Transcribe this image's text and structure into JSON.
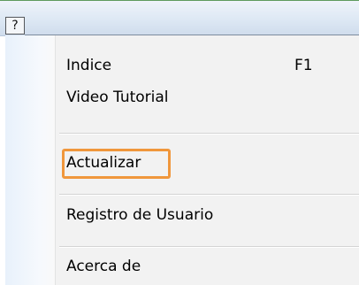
{
  "menubar": {
    "help_label": "?"
  },
  "menu": {
    "items": [
      {
        "label": "Indice",
        "shortcut": "F1"
      },
      {
        "label": "Video Tutorial",
        "shortcut": ""
      },
      {
        "label": "Actualizar",
        "shortcut": ""
      },
      {
        "label": "Registro de Usuario",
        "shortcut": ""
      },
      {
        "label": "Acerca de",
        "shortcut": ""
      }
    ]
  },
  "colors": {
    "highlight_border": "#f0973c",
    "menubar_top": "#eef3fa",
    "menu_background": "#f2f2f2"
  }
}
